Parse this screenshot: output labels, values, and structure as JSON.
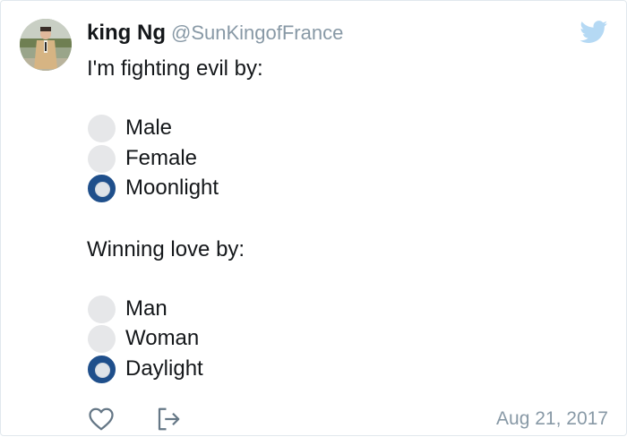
{
  "tweet": {
    "author_name": "king Ng",
    "author_handle": "@SunKingofFrance",
    "line1": "I'm fighting evil by:",
    "poll1": [
      {
        "label": "Male",
        "selected": false
      },
      {
        "label": "Female",
        "selected": false
      },
      {
        "label": "Moonlight",
        "selected": true
      }
    ],
    "line2": "Winning love by:",
    "poll2": [
      {
        "label": "Man",
        "selected": false
      },
      {
        "label": "Woman",
        "selected": false
      },
      {
        "label": "Daylight",
        "selected": true
      }
    ],
    "date": "Aug 21, 2017"
  },
  "icons": {
    "brand": "twitter-bird-icon",
    "like": "heart-icon",
    "share": "share-icon"
  },
  "colors": {
    "text": "#14171a",
    "muted": "#8899a6",
    "radio_selected": "#1f4f8b",
    "radio_unselected": "#e6e7e9"
  }
}
